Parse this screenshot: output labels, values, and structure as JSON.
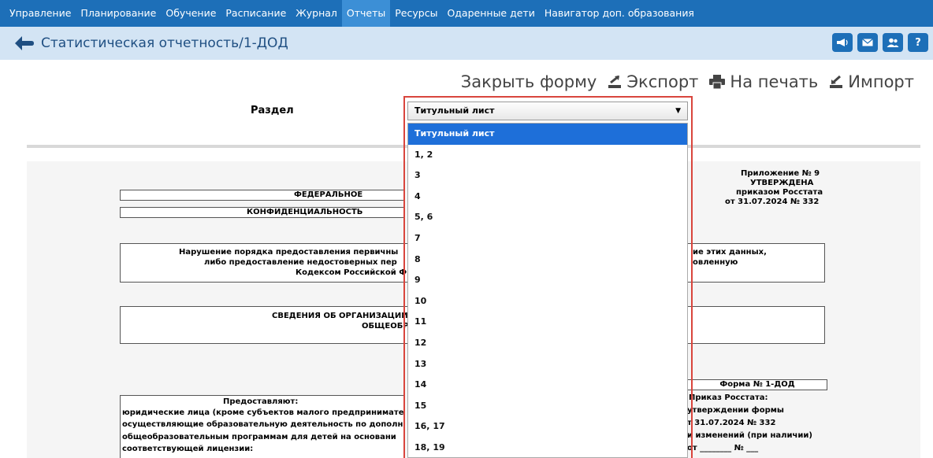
{
  "nav": {
    "items": [
      "Управление",
      "Планирование",
      "Обучение",
      "Расписание",
      "Журнал",
      "Отчеты",
      "Ресурсы",
      "Одаренные дети",
      "Навигатор доп. образования"
    ]
  },
  "header": {
    "title": "Статистическая отчетность/1-ДОД"
  },
  "header_icons": [
    "megaphone-icon",
    "mail-icon",
    "users-icon",
    "help-icon"
  ],
  "header_help_label": "?",
  "actions": {
    "close": "Закрыть форму",
    "export": "Экспорт",
    "print": "На печать",
    "import": "Импорт"
  },
  "section": {
    "label": "Раздел",
    "selected": "Титульный лист",
    "options": [
      "Титульный лист",
      "1, 2",
      "3",
      "4",
      "5, 6",
      "7",
      "8",
      "9",
      "10",
      "11",
      "12",
      "13",
      "14",
      "15",
      "16, 17",
      "18, 19"
    ]
  },
  "doc": {
    "appendix": [
      "Приложение № 9",
      "УТВЕРЖДЕНА",
      "приказом Росстата",
      "от 31.07.2024 № 332"
    ],
    "federal": "ФЕДЕРАЛЬНОЕ СТАТИСТ",
    "confidential": "КОНФИДЕНЦИАЛЬНОСТЬ ГАРАНТИР",
    "violation": [
      "Нарушение порядка предоставления первичны",
      "либо предоставление недостоверных пер",
      "Кодексом Российской Ф"
    ],
    "violation_right": [
      "ие этих данных,",
      "овленную"
    ],
    "info": [
      "СВЕДЕНИЯ ОБ ОРГАНИЗАЦИИ",
      "ОБЩЕОБР"
    ],
    "provide_title": "Предоставляют:",
    "provide_lines": [
      "юридические лица (кроме субъектов малого предпринимате",
      "осуществляющие образовательную деятельность по дополн",
      "общеобразовательным программам для детей на основани",
      "соответствующей лицензии:"
    ],
    "form_no": "Форма № 1-ДОД",
    "form_lines": [
      "Приказ Росстата:",
      "утверждении формы",
      "т 31.07.2024 № 332",
      "и изменений (при наличии)",
      "от ________ № ___"
    ]
  }
}
